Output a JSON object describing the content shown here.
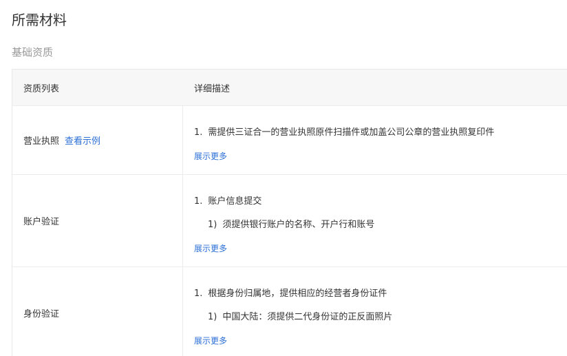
{
  "title": "所需材料",
  "section": "基础资质",
  "table": {
    "headers": [
      "资质列表",
      "详细描述"
    ],
    "rows": [
      {
        "label": "营业执照",
        "link": "查看示例",
        "items": [
          "需提供三证合一的营业执照原件扫描件或加盖公司公章的营业执照复印件"
        ],
        "item_nums": [
          "1."
        ],
        "subitems": [],
        "more": "展示更多"
      },
      {
        "label": "账户验证",
        "items": [
          "账户信息提交"
        ],
        "item_nums": [
          "1."
        ],
        "subitems": [
          "须提供银行账户的名称、开户行和账号"
        ],
        "subitem_nums": [
          "1)"
        ],
        "more": "展示更多"
      },
      {
        "label": "身份验证",
        "items": [
          "根据身份归属地，提供相应的经营者身份证件"
        ],
        "item_nums": [
          "1."
        ],
        "subitems": [
          "中国大陆：须提供二代身份证的正反面照片"
        ],
        "subitem_nums": [
          "1)"
        ],
        "more": "展示更多"
      }
    ]
  }
}
